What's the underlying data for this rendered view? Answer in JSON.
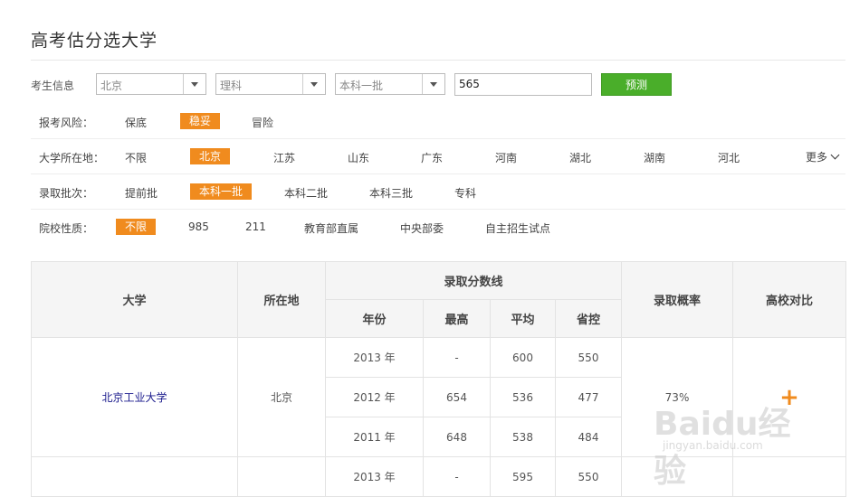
{
  "page": {
    "title": "高考估分选大学"
  },
  "info": {
    "label": "考生信息",
    "region": "北京",
    "subject": "理科",
    "batch": "本科一批",
    "score": "565",
    "predict_label": "预测"
  },
  "filters": {
    "risk": {
      "label": "报考风险：",
      "options": [
        "保底",
        "稳妥",
        "冒险"
      ],
      "selected": "稳妥"
    },
    "location": {
      "label": "大学所在地：",
      "options": [
        "不限",
        "北京",
        "江苏",
        "山东",
        "广东",
        "河南",
        "湖北",
        "湖南",
        "河北"
      ],
      "selected": "北京",
      "more": "更多"
    },
    "batch": {
      "label": "录取批次：",
      "options": [
        "提前批",
        "本科一批",
        "本科二批",
        "本科三批",
        "专科"
      ],
      "selected": "本科一批"
    },
    "nature": {
      "label": "院校性质：",
      "options": [
        "不限",
        "985",
        "211",
        "教育部直属",
        "中央部委",
        "自主招生试点"
      ],
      "selected": "不限"
    }
  },
  "table": {
    "headers": {
      "university": "大学",
      "location": "所在地",
      "score_line": "录取分数线",
      "probability": "录取概率",
      "compare": "高校对比"
    },
    "sub_headers": {
      "year": "年份",
      "max": "最高",
      "avg": "平均",
      "control": "省控"
    },
    "rows": [
      {
        "university": "北京工业大学",
        "location": "北京",
        "probability": "73%",
        "compare": "+",
        "years": [
          {
            "year": "2013 年",
            "max": "-",
            "avg": "600",
            "control": "550"
          },
          {
            "year": "2012 年",
            "max": "654",
            "avg": "536",
            "control": "477"
          },
          {
            "year": "2011 年",
            "max": "648",
            "avg": "538",
            "control": "484"
          }
        ]
      },
      {
        "years": [
          {
            "year": "2013 年",
            "max": "-",
            "avg": "595",
            "control": "550"
          }
        ]
      }
    ]
  },
  "watermark": {
    "brand": "Baidu经验",
    "url": "jingyan.baidu.com"
  }
}
